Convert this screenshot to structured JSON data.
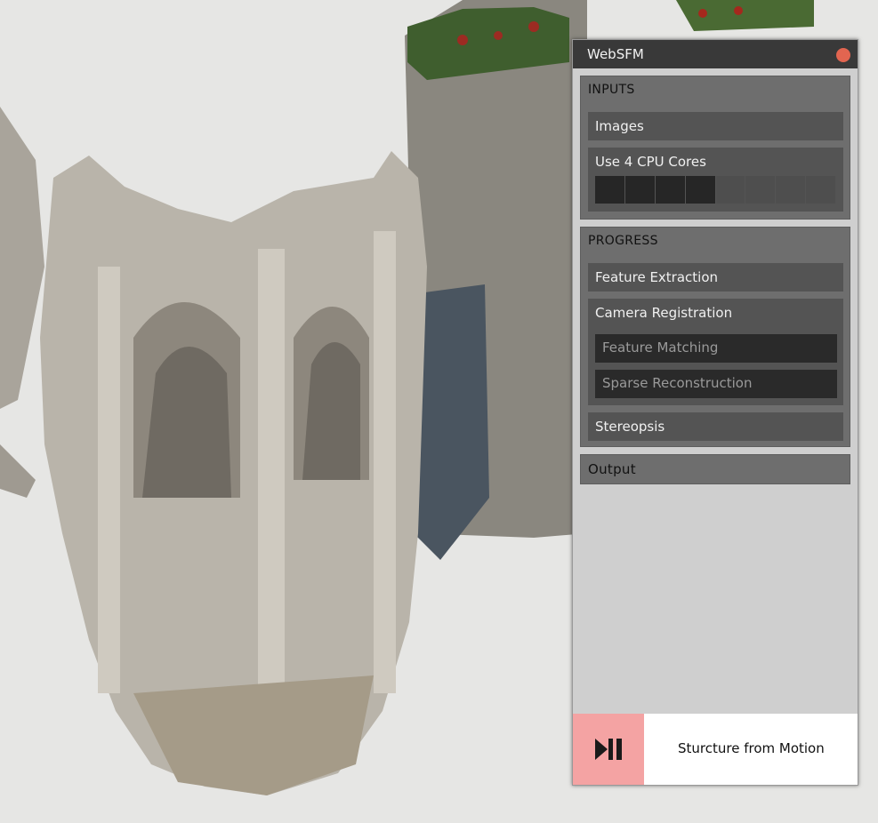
{
  "window": {
    "title": "WebSFM"
  },
  "inputs": {
    "header": "INPUTS",
    "images_label": "Images",
    "cpu_label": "Use 4 CPU Cores",
    "cpu_cores_selected": 4,
    "cpu_cores_total": 8
  },
  "progress": {
    "header": "PROGRESS",
    "feature_extraction": "Feature Extraction",
    "camera_registration": "Camera Registration",
    "feature_matching": "Feature Matching",
    "sparse_reconstruction": "Sparse Reconstruction",
    "stereopsis": "Stereopsis"
  },
  "output": {
    "header": "Output"
  },
  "footer": {
    "label": "Sturcture from Motion",
    "play_icon": "play-pause-icon"
  },
  "colors": {
    "close": "#e26550",
    "play_bg": "#f4a3a3",
    "panel_bg": "#cfcfcf",
    "titlebar": "#393939"
  }
}
